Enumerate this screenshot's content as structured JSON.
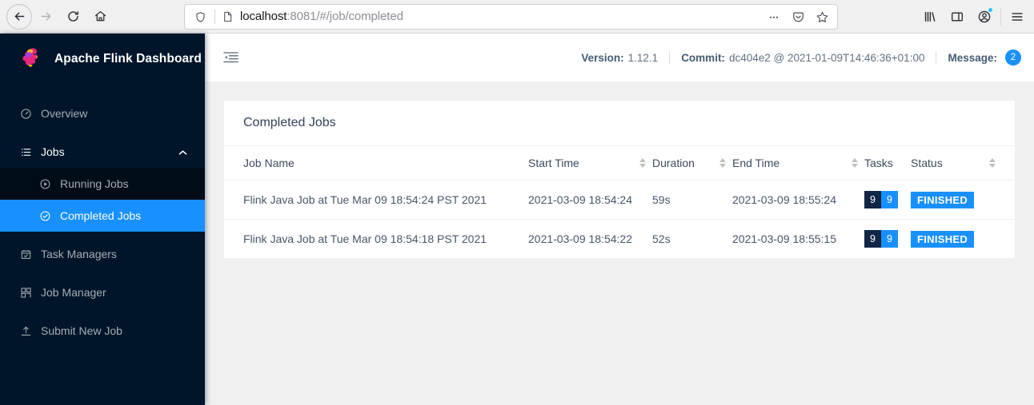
{
  "browser": {
    "back_icon": "back-arrow-icon",
    "forward_icon": "forward-arrow-icon",
    "reload_icon": "reload-icon",
    "home_icon": "home-icon",
    "url_host": "localhost",
    "url_path": ":8081/#/job/completed",
    "url_full": "localhost:8081/#/job/completed",
    "shield_icon": "tracking-protection-shield-icon",
    "page_icon": "page-document-icon",
    "page_actions_icon": "page-actions-ellipsis-icon",
    "pocket_icon": "pocket-icon",
    "bookmark_icon": "bookmark-star-icon",
    "library_icon": "library-icon",
    "sidebar_icon": "sidebar-toggle-icon",
    "account_icon": "account-avatar-icon",
    "menu_icon": "hamburger-menu-icon"
  },
  "sidebar": {
    "brand_title": "Apache Flink Dashboard",
    "logo_icon": "flink-squirrel-logo",
    "items": [
      {
        "label": "Overview",
        "icon": "dashboard-icon"
      },
      {
        "label": "Jobs",
        "icon": "list-icon",
        "chevron": "chevron-up-icon"
      },
      {
        "label": "Running Jobs",
        "icon": "play-circle-icon"
      },
      {
        "label": "Completed Jobs",
        "icon": "check-circle-icon"
      },
      {
        "label": "Task Managers",
        "icon": "calendar-check-icon"
      },
      {
        "label": "Job Manager",
        "icon": "cluster-icon"
      },
      {
        "label": "Submit New Job",
        "icon": "upload-icon"
      }
    ],
    "active_item": "Completed Jobs",
    "bg_color": "#001529",
    "submenu_bg_color": "#000c17",
    "accent_color": "#1890ff"
  },
  "topbar": {
    "collapse_icon": "menu-fold-icon",
    "version_label": "Version:",
    "version_value": "1.12.1",
    "commit_label": "Commit:",
    "commit_value": "dc404e2 @ 2021-01-09T14:46:36+01:00",
    "message_label": "Message:",
    "message_count": "2"
  },
  "card": {
    "title": "Completed Jobs",
    "columns": [
      {
        "label": "Job Name",
        "sortable": false
      },
      {
        "label": "Start Time",
        "sortable": true
      },
      {
        "label": "Duration",
        "sortable": true
      },
      {
        "label": "End Time",
        "sortable": true
      },
      {
        "label": "Tasks",
        "sortable": false
      },
      {
        "label": "Status",
        "sortable": true
      }
    ],
    "rows": [
      {
        "job_name": "Flink Java Job at Tue Mar 09 18:54:24 PST 2021",
        "start_time": "2021-03-09 18:54:24",
        "duration": "59s",
        "end_time": "2021-03-09 18:55:24",
        "tasks_total": "9",
        "tasks_finished": "9",
        "status": "FINISHED"
      },
      {
        "job_name": "Flink Java Job at Tue Mar 09 18:54:18 PST 2021",
        "start_time": "2021-03-09 18:54:22",
        "duration": "52s",
        "end_time": "2021-03-09 18:55:15",
        "tasks_total": "9",
        "tasks_finished": "9",
        "status": "FINISHED"
      }
    ]
  }
}
